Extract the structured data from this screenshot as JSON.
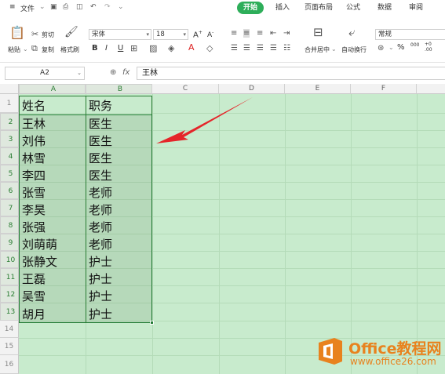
{
  "menu": {
    "hamburger": "≡",
    "file": "文件",
    "quick_icons": [
      "save-icon",
      "print-icon",
      "preview-icon",
      "undo-icon",
      "redo-icon",
      "customize-icon"
    ]
  },
  "tabs": [
    {
      "label": "开始",
      "active": true
    },
    {
      "label": "插入",
      "active": false
    },
    {
      "label": "页面布局",
      "active": false
    },
    {
      "label": "公式",
      "active": false
    },
    {
      "label": "数据",
      "active": false
    },
    {
      "label": "审阅",
      "active": false
    }
  ],
  "clipboard": {
    "paste": "粘贴",
    "cut": "剪切",
    "copy": "复制",
    "format_painter": "格式刷"
  },
  "font": {
    "name": "宋体",
    "size": "18",
    "bold": "B",
    "italic": "I",
    "underline": "U"
  },
  "alignment": {
    "merge_center": "合并居中",
    "wrap": "自动换行"
  },
  "number": {
    "format": "常规",
    "percent": "%",
    "thousands": "000"
  },
  "formula_bar": {
    "name_box": "A2",
    "fx": "fx",
    "value": "王林"
  },
  "columns": [
    "A",
    "B",
    "C",
    "D",
    "E",
    "F"
  ],
  "rows": [
    "1",
    "2",
    "3",
    "4",
    "5",
    "6",
    "7",
    "8",
    "9",
    "10",
    "11",
    "12",
    "13",
    "14",
    "15",
    "16"
  ],
  "table": [
    [
      "姓名",
      "职务"
    ],
    [
      "王林",
      "医生"
    ],
    [
      "刘伟",
      "医生"
    ],
    [
      "林雪",
      "医生"
    ],
    [
      "李四",
      "医生"
    ],
    [
      "张雪",
      "老师"
    ],
    [
      "李昊",
      "老师"
    ],
    [
      "张强",
      "老师"
    ],
    [
      "刘萌萌",
      "老师"
    ],
    [
      "张静文",
      "护士"
    ],
    [
      "王磊",
      "护士"
    ],
    [
      "吴雪",
      "护士"
    ],
    [
      "胡月",
      "护士"
    ]
  ],
  "colors": {
    "accent": "#2eae5a",
    "sheet_bg": "#c8ebcd",
    "arrow": "#e5252a",
    "selection": "#1f7a32",
    "watermark": "#e8821e"
  },
  "watermark": {
    "title": "Office教程网",
    "url": "www.office26.com"
  }
}
